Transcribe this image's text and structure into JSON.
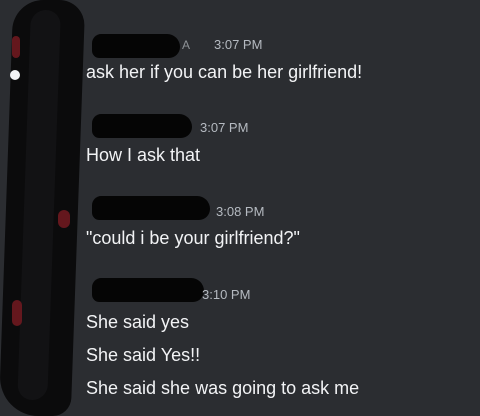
{
  "messages": [
    {
      "time": "3:07 PM",
      "tag": "A",
      "lines": [
        "ask her if you can be her girlfriend!"
      ]
    },
    {
      "time": "3:07 PM",
      "lines": [
        "How I ask that"
      ]
    },
    {
      "time": "3:08 PM",
      "lines": [
        "\"could i be your girlfriend?\""
      ]
    },
    {
      "time": "3:10 PM",
      "lines": [
        "She said yes",
        "She said Yes!!",
        "She said she was going to ask me"
      ]
    }
  ]
}
